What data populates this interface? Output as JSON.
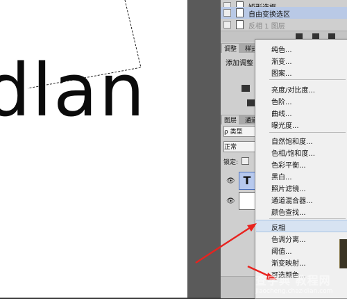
{
  "canvas": {
    "text": "dlan"
  },
  "history": {
    "items": [
      {
        "label": "矩形选框",
        "state": "normal"
      },
      {
        "label": "自由变换选区",
        "state": "selected"
      },
      {
        "label": "反相 1 图层",
        "state": "dimmed"
      }
    ]
  },
  "adjustments": {
    "tabs": [
      "调整",
      "样式"
    ],
    "title": "添加调整"
  },
  "layers": {
    "tabs": [
      "图层",
      "通道"
    ],
    "search_label": "ρ 类型",
    "blend_mode": "正常",
    "lock_label": "锁定:",
    "layer_rows": [
      {
        "thumb": "T"
      },
      {
        "thumb": ""
      }
    ]
  },
  "menu": {
    "groups": [
      [
        "纯色...",
        "渐变...",
        "图案..."
      ],
      [
        "亮度/对比度...",
        "色阶...",
        "曲线...",
        "曝光度..."
      ],
      [
        "自然饱和度...",
        "色相/饱和度...",
        "色彩平衡...",
        "黑白...",
        "照片滤镜...",
        "通道混合器...",
        "颜色查找..."
      ],
      [
        "反相",
        "色调分离...",
        "阈值...",
        "渐变映射...",
        "可选颜色..."
      ]
    ],
    "highlighted": "反相"
  },
  "watermark": {
    "text": "查字典 教程网",
    "url": "jiaocheng.chazidian.com"
  },
  "colors": {
    "arrow": "#e8231f",
    "menu_highlight": "#d7e3f2",
    "history_selected": "#b9c9e6"
  }
}
